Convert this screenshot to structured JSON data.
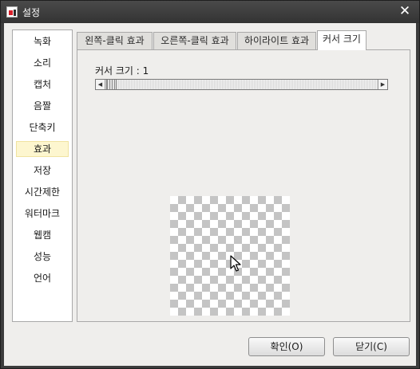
{
  "window": {
    "title": "설정",
    "icon": "app-icon",
    "close_glyph": "✕"
  },
  "sidebar": {
    "items": [
      {
        "label": "녹화",
        "selected": false
      },
      {
        "label": "소리",
        "selected": false
      },
      {
        "label": "캡처",
        "selected": false
      },
      {
        "label": "음짤",
        "selected": false
      },
      {
        "label": "단축키",
        "selected": false
      },
      {
        "label": "효과",
        "selected": true
      },
      {
        "label": "저장",
        "selected": false
      },
      {
        "label": "시간제한",
        "selected": false
      },
      {
        "label": "워터마크",
        "selected": false
      },
      {
        "label": "웹캠",
        "selected": false
      },
      {
        "label": "성능",
        "selected": false
      },
      {
        "label": "언어",
        "selected": false
      }
    ]
  },
  "tabs": [
    {
      "label": "왼쪽-클릭 효과",
      "active": false
    },
    {
      "label": "오른쪽-클릭 효과",
      "active": false
    },
    {
      "label": "하이라이트 효과",
      "active": false
    },
    {
      "label": "커서 크기",
      "active": true
    }
  ],
  "cursor_size": {
    "label": "커서 크기 : 1",
    "slider_value": 1,
    "left_arrow": "◀",
    "right_arrow": "▶"
  },
  "preview": {
    "icon": "mouse-cursor-icon"
  },
  "buttons": {
    "ok": "확인(O)",
    "close": "닫기(C)"
  },
  "colors": {
    "titlebar": "#3c3c3c",
    "selected_item": "#fdf6cf",
    "panel": "#efeeec"
  }
}
